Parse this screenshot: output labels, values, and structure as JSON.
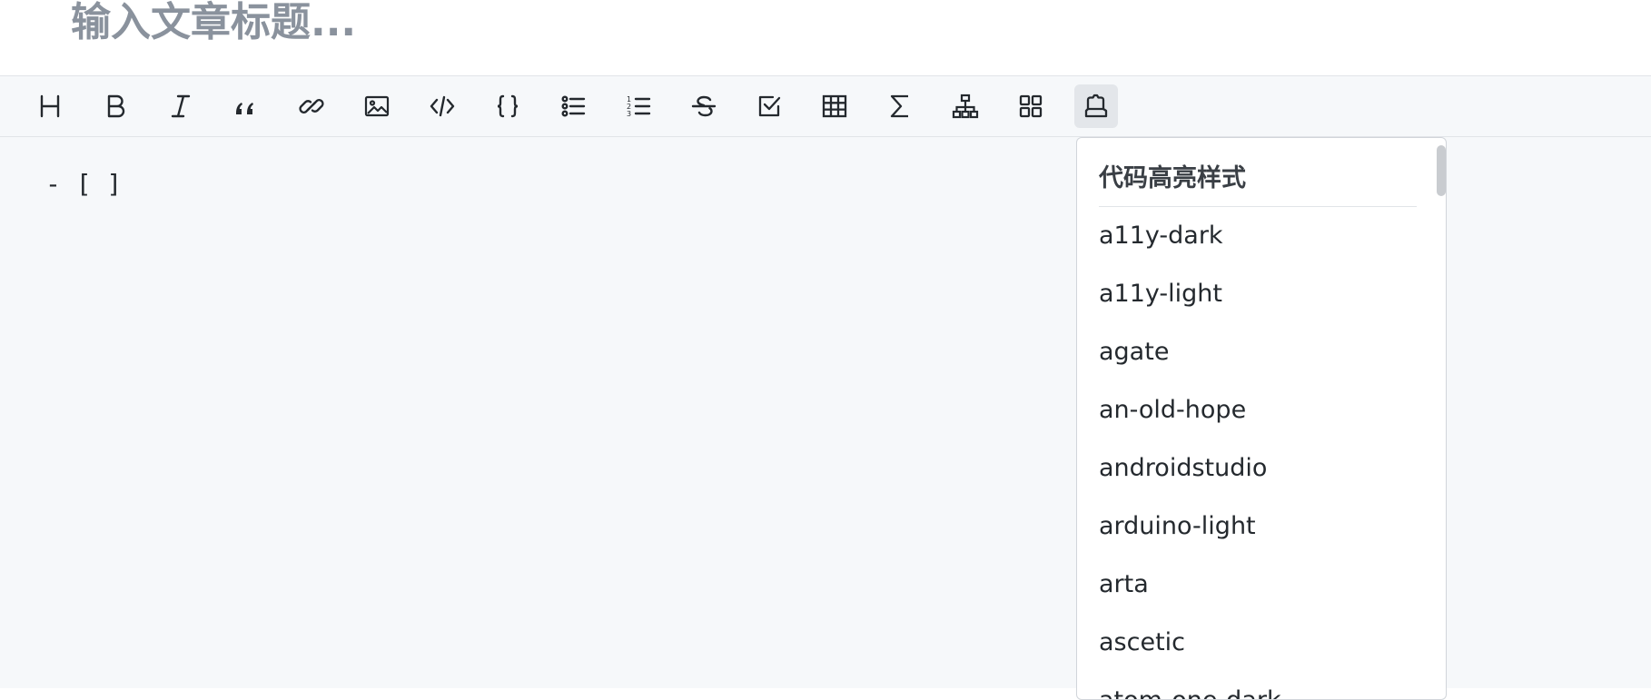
{
  "title": {
    "placeholder": "输入文章标题..."
  },
  "toolbar": {
    "buttons": [
      {
        "icon": "heading-icon"
      },
      {
        "icon": "bold-icon"
      },
      {
        "icon": "italic-icon"
      },
      {
        "icon": "quote-icon"
      },
      {
        "icon": "link-icon"
      },
      {
        "icon": "image-icon"
      },
      {
        "icon": "code-icon"
      },
      {
        "icon": "code-block-icon"
      },
      {
        "icon": "unordered-list-icon"
      },
      {
        "icon": "ordered-list-icon"
      },
      {
        "icon": "strikethrough-icon"
      },
      {
        "icon": "task-list-icon"
      },
      {
        "icon": "table-icon"
      },
      {
        "icon": "math-icon"
      },
      {
        "icon": "diagram-icon"
      },
      {
        "icon": "grid-icon"
      },
      {
        "icon": "code-theme-icon",
        "active": true
      }
    ]
  },
  "editor": {
    "content": "- [ ]"
  },
  "dropdown": {
    "title": "代码高亮样式",
    "items": [
      "a11y-dark",
      "a11y-light",
      "agate",
      "an-old-hope",
      "androidstudio",
      "arduino-light",
      "arta",
      "ascetic",
      "atom-one-dark"
    ]
  },
  "colors": {
    "toolbar_bg": "#f6f8fa",
    "active_button_bg": "#e3e6ea",
    "placeholder": "#8a929d",
    "text": "#24292e"
  }
}
